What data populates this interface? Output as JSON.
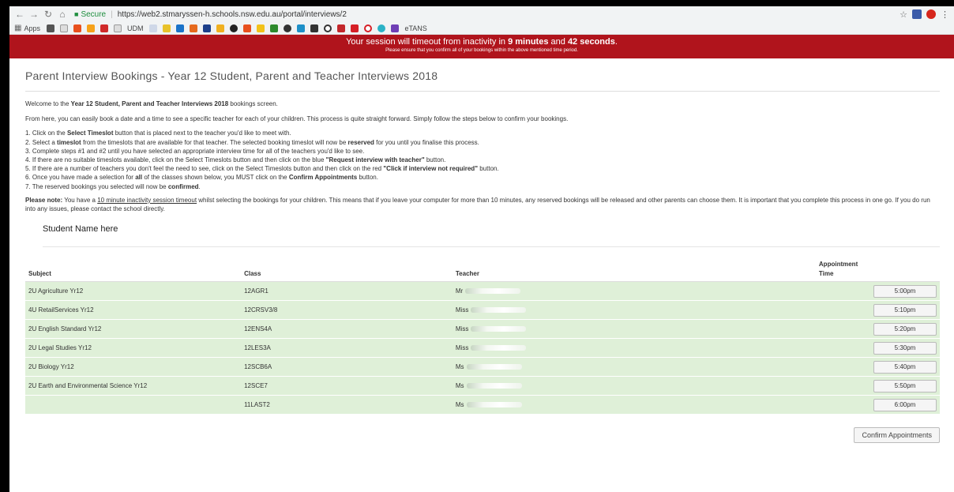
{
  "browser": {
    "url_secure": "Secure",
    "url": "https://web2.stmaryssen-h.schools.nsw.edu.au/portal/interviews/2",
    "bookmarks_apps": "Apps",
    "bookmark_udm": "UDM",
    "bookmark_etans": "eTANS"
  },
  "banner": {
    "prefix": "Your session will timeout from inactivity in",
    "minutes": "9 minutes",
    "and": "and",
    "seconds": "42 seconds",
    "period": ".",
    "sub": "Please ensure that you confirm all of your bookings within the above mentioned time period."
  },
  "page": {
    "title": "Parent Interview Bookings - Year 12 Student, Parent and Teacher Interviews 2018",
    "welcome_pre": "Welcome to the",
    "welcome_bold": "Year 12 Student, Parent and Teacher Interviews 2018",
    "welcome_post": "bookings screen.",
    "intro": "From here, you can easily book a date and a time to see a specific teacher for each of your children. This process is quite straight forward. Simply follow the steps below to confirm your bookings.",
    "steps": {
      "s1a": "1. Click on the",
      "s1b": "Select Timeslot",
      "s1c": "button that is placed next to the teacher you'd like to meet with.",
      "s2a": "2. Select a",
      "s2b": "timeslot",
      "s2c": "from the timeslots that are available for that teacher. The selected booking timeslot will now be",
      "s2d": "reserved",
      "s2e": "for you until you finalise this process.",
      "s3": "3. Complete steps #1 and #2 until you have selected an appropriate interview time for all of the teachers you'd like to see.",
      "s4a": "4. If there are no suitable timeslots available, click on the Select Timeslots button and then click on the blue",
      "s4b": "\"Request interview with teacher\"",
      "s4c": "button.",
      "s5a": "5. If there are a number of teachers you don't feel the need to see, click on the Select Timeslots button and then click on the red",
      "s5b": "\"Click if interview not required\"",
      "s5c": "button.",
      "s6a": "6. Once you have made a selection for",
      "s6b": "all",
      "s6c": "of the classes shown below, you MUST click on the",
      "s6d": "Confirm Appointments",
      "s6e": "button.",
      "s7a": "7. The reserved bookings you selected will now be",
      "s7b": "confirmed",
      "s7c": "."
    },
    "note_label": "Please note:",
    "note_pre": "You have a",
    "note_link": "10 minute inactivity session timeout",
    "note_post": "whilst selecting the bookings for your children. This means that if you leave your computer for more than 10 minutes, any reserved bookings will be released and other parents can choose them. It is important that you complete this process in one go. If you do run into any issues, please contact the school directly.",
    "student_name": "Student Name here"
  },
  "table": {
    "headers": {
      "subject": "Subject",
      "class": "Class",
      "teacher": "Teacher",
      "time": "Appointment Time"
    },
    "rows": [
      {
        "subject": "2U Agriculture Yr12",
        "class": "12AGR1",
        "teacher": "Mr",
        "time": "5:00pm"
      },
      {
        "subject": "4U RetailServices Yr12",
        "class": "12CRSV3/8",
        "teacher": "Miss",
        "time": "5:10pm"
      },
      {
        "subject": "2U English Standard Yr12",
        "class": "12ENS4A",
        "teacher": "Miss",
        "time": "5:20pm"
      },
      {
        "subject": "2U Legal Studies Yr12",
        "class": "12LES3A",
        "teacher": "Miss",
        "time": "5:30pm"
      },
      {
        "subject": "2U Biology Yr12",
        "class": "12SCB6A",
        "teacher": "Ms",
        "time": "5:40pm"
      },
      {
        "subject": "2U Earth and Environmental Science Yr12",
        "class": "12SCE7",
        "teacher": "Ms",
        "time": "5:50pm"
      },
      {
        "subject": "",
        "class": "11LAST2",
        "teacher": "Ms",
        "time": "6:00pm"
      }
    ]
  },
  "confirm_label": "Confirm Appointments",
  "colors": {
    "banner": "#b0141c",
    "row": "#dff0d8"
  }
}
